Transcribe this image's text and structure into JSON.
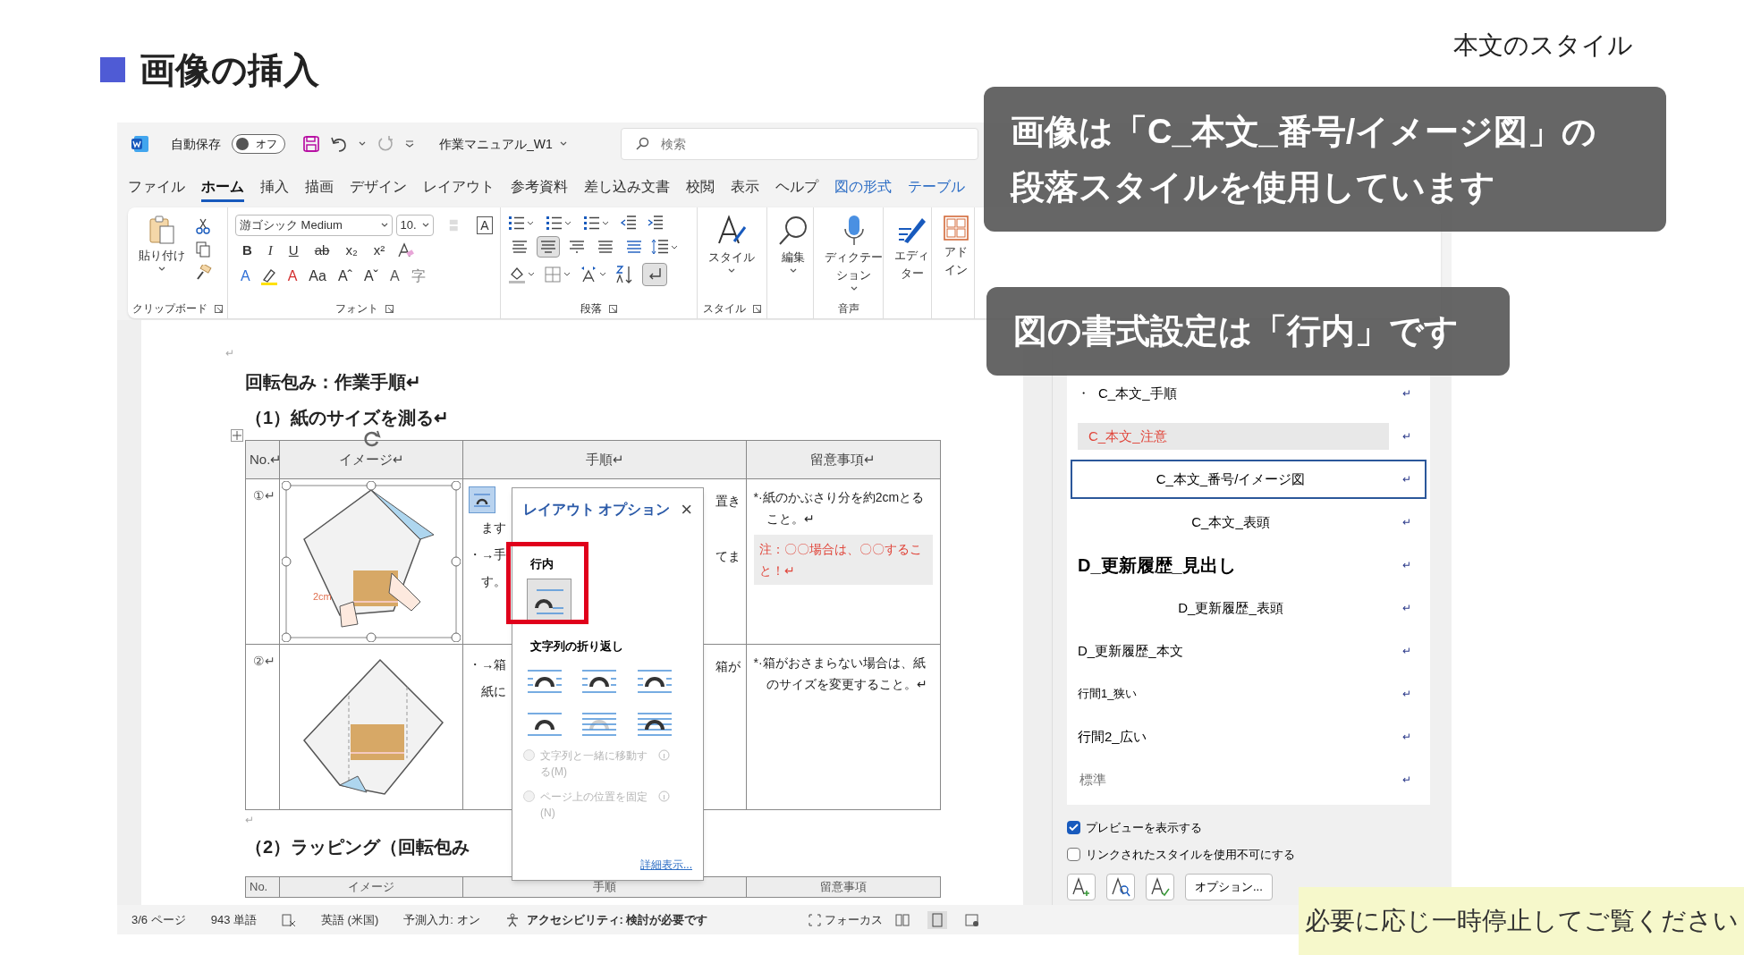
{
  "slide": {
    "title": "画像の挿入",
    "caption": "本文のスタイル"
  },
  "titlebar": {
    "autosave_label": "自動保存",
    "autosave": {
      "on": false,
      "label": "オフ"
    },
    "document_name": "作業マニュアル_W1",
    "search_placeholder": "検索"
  },
  "menu_tabs": [
    {
      "label": "ファイル",
      "selected": false,
      "contextual": false
    },
    {
      "label": "ホーム",
      "selected": true,
      "contextual": false
    },
    {
      "label": "挿入",
      "selected": false,
      "contextual": false
    },
    {
      "label": "描画",
      "selected": false,
      "contextual": false
    },
    {
      "label": "デザイン",
      "selected": false,
      "contextual": false
    },
    {
      "label": "レイアウト",
      "selected": false,
      "contextual": false
    },
    {
      "label": "参考資料",
      "selected": false,
      "contextual": false
    },
    {
      "label": "差し込み文書",
      "selected": false,
      "contextual": false
    },
    {
      "label": "校閲",
      "selected": false,
      "contextual": false
    },
    {
      "label": "表示",
      "selected": false,
      "contextual": false
    },
    {
      "label": "ヘルプ",
      "selected": false,
      "contextual": false
    },
    {
      "label": "図の形式",
      "selected": false,
      "contextual": true
    },
    {
      "label": "テーブル",
      "selected": false,
      "contextual": true
    }
  ],
  "ribbon": {
    "clipboard": {
      "paste_label": "貼り付け",
      "group_label": "クリップボード"
    },
    "font": {
      "name": "游ゴシック Medium",
      "size": "10.",
      "box_glyph": "A",
      "row2": [
        "B",
        "I",
        "U",
        "ab",
        "x₂",
        "x²"
      ],
      "row3": [
        {
          "glyph": "A",
          "color": "#2f6fd6"
        },
        {
          "glyph": "A",
          "color": "#d32f2f"
        },
        {
          "glyph": "Aa",
          "color": "#333333"
        },
        {
          "glyph": "Aˆ",
          "color": "#333333"
        },
        {
          "glyph": "Aˇ",
          "color": "#333333"
        },
        {
          "glyph": "A",
          "color": "#555555"
        },
        {
          "glyph": "字",
          "color": "#888888"
        }
      ],
      "group_label": "フォント"
    },
    "paragraph": {
      "alignments": [
        {
          "selected": false
        },
        {
          "selected": true
        },
        {
          "selected": false
        },
        {
          "selected": false
        },
        {
          "selected": false
        }
      ],
      "show_marks": true,
      "group_label": "段落"
    },
    "styles": {
      "button_label": "スタイル",
      "group_label": "スタイル"
    },
    "edit": {
      "button_label": "編集"
    },
    "voice": {
      "button_lines": [
        "ディクテー",
        "ション"
      ],
      "group_label": "音声"
    },
    "editor": {
      "button_lines": [
        "エディ",
        "ター"
      ]
    },
    "addin": {
      "button_lines": [
        "アド",
        "イン"
      ]
    }
  },
  "document": {
    "top_mark": "↵",
    "heading": "回転包み：作業手順↵",
    "subheading": "（1）紙のサイズを測る↵",
    "table": {
      "columns": [
        "No.↵",
        "イメージ↵",
        "手順↵",
        "留意事項↵"
      ],
      "rows": [
        {
          "number": "①↵",
          "image_selected": true,
          "image_label": "2cm",
          "steps_left": [
            "ます",
            "・→手",
            "す。"
          ],
          "steps_right": [
            "置き",
            "てま"
          ],
          "notes": "*·紙のかぶさり分を約2cmとること。↵",
          "warning": "注：〇〇場合は、〇〇すること！↵"
        },
        {
          "number": "②↵",
          "image_selected": false,
          "steps_left": [
            "・→箱",
            "紙に"
          ],
          "steps_right": [
            "箱が"
          ],
          "notes": "*·箱がおさまらない場合は、紙のサイズを変更すること。↵"
        }
      ]
    },
    "after_mark": "↵",
    "subheading_2": "（2）ラッピング（回転包み",
    "table_2": {
      "columns": [
        "No.",
        "イメージ",
        "手順",
        "留意事項"
      ]
    }
  },
  "layout_popup": {
    "title": "レイアウト オプション",
    "close": "×",
    "inline_label": "行内",
    "inline_selected": true,
    "wrap_label": "文字列の折り返し",
    "wrap_options": [
      {
        "kind": "square",
        "selected": false
      },
      {
        "kind": "tight",
        "selected": false
      },
      {
        "kind": "through",
        "selected": false
      },
      {
        "kind": "topbottom",
        "selected": false
      },
      {
        "kind": "behind",
        "selected": false
      },
      {
        "kind": "front",
        "selected": false
      }
    ],
    "radios": [
      {
        "label": "文字列と一緒に移動する(M)",
        "disabled": true
      },
      {
        "label": "ページ上の位置を固定(N)",
        "disabled": true
      }
    ],
    "more_link": "詳細表示..."
  },
  "styles_pane": {
    "items": [
      {
        "label": "C_本文_手順",
        "bullet": "・",
        "kind": "bullet",
        "selected": false,
        "mark": "↵"
      },
      {
        "label": "C_本文_注意",
        "kind": "note",
        "selected": false,
        "mark": "↵"
      },
      {
        "label": "C_本文_番号/イメージ図",
        "kind": "centered",
        "selected": true,
        "mark": "↵"
      },
      {
        "label": "C_本文_表頭",
        "kind": "centered",
        "selected": false,
        "mark": "↵"
      },
      {
        "label": "D_更新履歴_見出し",
        "kind": "heading",
        "selected": false,
        "mark": "↵"
      },
      {
        "label": "D_更新履歴_表頭",
        "kind": "centered",
        "selected": false,
        "mark": "↵"
      },
      {
        "label": "D_更新履歴_本文",
        "kind": "plain",
        "selected": false,
        "mark": "↵"
      },
      {
        "label": "行間1_狭い",
        "kind": "small",
        "selected": false,
        "mark": "↵"
      },
      {
        "label": "行間2_広い",
        "kind": "plain",
        "selected": false,
        "mark": "↵"
      },
      {
        "label": "標準",
        "kind": "serif",
        "selected": false,
        "mark": "↵"
      }
    ],
    "checkboxes": [
      {
        "label": "プレビューを表示する",
        "checked": true
      },
      {
        "label": "リンクされたスタイルを使用不可にする",
        "checked": false
      }
    ],
    "options_button": "オプション..."
  },
  "status_bar": {
    "page": "3/6 ページ",
    "words": "943 単語",
    "language": "英語 (米国)",
    "prediction": "予測入力: オン",
    "accessibility": "アクセシビリティ: 検討が必要です",
    "focus": "フォーカス"
  },
  "callouts": [
    "画像は「C_本文_番号/イメージ図」の段落スタイルを使用しています",
    "図の書式設定は「行内」です"
  ],
  "banner": "必要に応じ一時停止してご覧ください"
}
